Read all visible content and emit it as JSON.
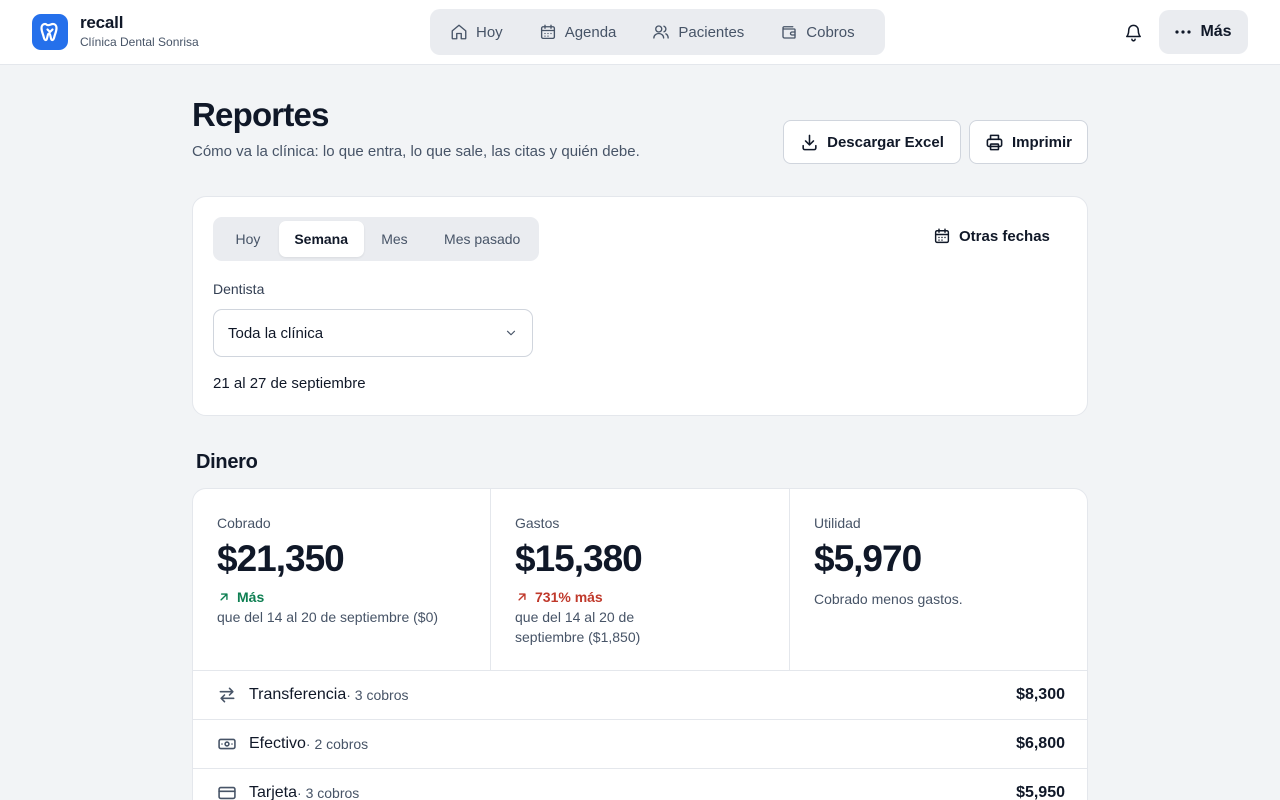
{
  "brand": {
    "name": "recall",
    "clinic": "Clínica Dental Sonrisa"
  },
  "nav": [
    {
      "label": "Hoy",
      "icon": "home-icon"
    },
    {
      "label": "Agenda",
      "icon": "calendar-icon"
    },
    {
      "label": "Pacientes",
      "icon": "users-icon"
    },
    {
      "label": "Cobros",
      "icon": "wallet-icon"
    }
  ],
  "header": {
    "more_label": "Más",
    "title": "Reportes",
    "subtitle": "Cómo va la clínica: lo que entra, lo que sale, las citas y quién debe.",
    "excel_label": "Descargar Excel",
    "print_label": "Imprimir"
  },
  "filters": {
    "periods": [
      "Hoy",
      "Semana",
      "Mes",
      "Mes pasado"
    ],
    "active_period": "Semana",
    "other_dates_label": "Otras fechas",
    "dentist_label": "Dentista",
    "dentist_value": "Toda la clínica",
    "range": "21 al 27 de septiembre"
  },
  "money": {
    "section_title": "Dinero",
    "collected": {
      "label": "Cobrado",
      "value": "$21,350",
      "trend": "Más",
      "note": "que del 14 al 20 de septiembre ($0)"
    },
    "expenses": {
      "label": "Gastos",
      "value": "$15,380",
      "trend": "731% más",
      "note_line1": "que del 14 al 20 de",
      "note_line2": "septiembre ($1,850)"
    },
    "profit": {
      "label": "Utilidad",
      "value": "$5,970",
      "note": "Cobrado menos gastos."
    },
    "methods": [
      {
        "name": "Transferencia",
        "count": " · 3 cobros",
        "amount": "$8,300",
        "icon": "transfer-icon"
      },
      {
        "name": "Efectivo",
        "count": " · 2 cobros",
        "amount": "$6,800",
        "icon": "cash-icon"
      },
      {
        "name": "Tarjeta",
        "count": " · 3 cobros",
        "amount": "$5,950",
        "icon": "card-icon"
      }
    ]
  },
  "colors": {
    "brand": "#2570eb",
    "positive": "#0e7f52",
    "negative": "#c0392b",
    "background": "#f2f4f6"
  }
}
